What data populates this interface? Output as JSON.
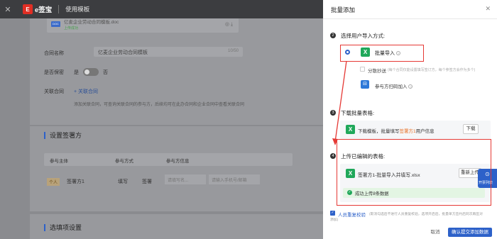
{
  "topbar": {
    "close_glyph": "✕",
    "logo_mark": "E",
    "logo_text": "e签宝",
    "title": "使用模板"
  },
  "page": {
    "doc_badge": "DOC",
    "doc_name": "亿麦企业劳动合同模板.doc",
    "doc_status": "上传成功",
    "contract_name_label": "合同名称",
    "contract_name_value": "亿麦企业劳动合同模板",
    "contract_name_count": "10/50",
    "encrypt_label": "是否保密",
    "encrypt_yes": "是",
    "encrypt_no": "否",
    "related_label": "关联合同",
    "related_link": "+ 关联合同",
    "related_desc": "添加关联合同，可查询关联合同的参与方，后续均可在此办合同和企业合同中查看关联合同",
    "sign_section": "设置签署方",
    "col_party": "参与主体",
    "col_method": "参与方式",
    "col_info": "参与方信息",
    "row_badge": "个人",
    "row_party": "签署方1",
    "row_fill": "填写",
    "row_sign": "签署",
    "row_ph1": "请填写名...",
    "row_ph2": "请输入手机号/邮箱",
    "options_section": "选填项设置"
  },
  "drawer": {
    "title": "批量添加",
    "close_glyph": "✕",
    "step2": {
      "num": "2",
      "label": "选择用户导入方式:"
    },
    "batch_import": "批量导入",
    "split_sign": "分散抄送",
    "split_sign_hint": "(每个合同仅能设置填写签订方，每个参签方会作为多个)",
    "scan_join": "参与方扫码加入",
    "step3": {
      "num": "3",
      "label": "下载批量表格:"
    },
    "download_prefix": "下载模板，批量填写",
    "download_highlight": "签署方1",
    "download_suffix": "用户信息",
    "download_btn": "下载",
    "step4": {
      "num": "4",
      "label": "上传已编辑的表格:"
    },
    "uploaded_file": "签署方1-批量导入并填写.xlsx",
    "reupload_btn": "重新上传",
    "success_msg": "成功上传8条数据",
    "float_btn": "开票列表",
    "dedupe_label": "人员重复校验",
    "dedupe_hint": "(取消勾选后不进行人员重复校验，选项开启后，批量单方签约后同次再签对",
    "dedupe_hint2": "添加)",
    "cancel_btn": "取消",
    "confirm_btn": "确认提交添加数据",
    "xl_glyph": "X",
    "help_glyph": "?",
    "check_glyph": "✓",
    "success_glyph": "✓",
    "float_glyph": "⊙",
    "scan_glyph": "⊟"
  },
  "colors": {
    "accent": "#2d61c9",
    "success": "#20a85a",
    "highlight": "#e8732a",
    "annot_red": "#e53935"
  }
}
